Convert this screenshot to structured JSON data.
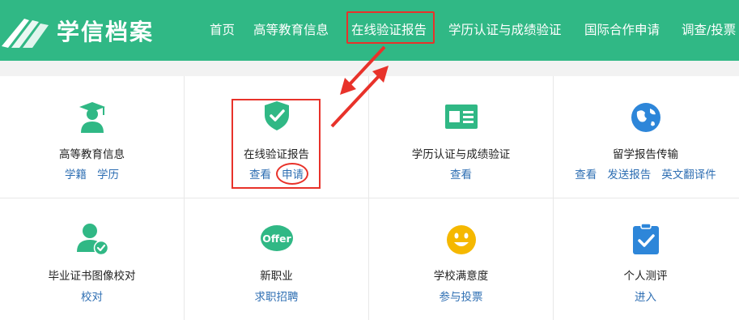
{
  "header": {
    "logo_text": "学信档案",
    "nav": [
      "首页",
      "高等教育信息",
      "在线验证报告",
      "学历认证与成绩验证",
      "国际合作申请",
      "调查/投票"
    ]
  },
  "cells": [
    {
      "title": "高等教育信息",
      "links": [
        "学籍",
        "学历"
      ],
      "icon": "graduate-icon"
    },
    {
      "title": "在线验证报告",
      "links": [
        "查看",
        "申请"
      ],
      "icon": "shield-check-icon"
    },
    {
      "title": "学历认证与成绩验证",
      "links": [
        "查看"
      ],
      "icon": "id-card-icon"
    },
    {
      "title": "留学报告传输",
      "links": [
        "查看",
        "发送报告",
        "英文翻译件"
      ],
      "icon": "globe-icon"
    },
    {
      "title": "毕业证书图像校对",
      "links": [
        "校对"
      ],
      "icon": "user-check-icon"
    },
    {
      "title": "新职业",
      "links": [
        "求职招聘"
      ],
      "icon": "offer-icon",
      "badge": "Offer"
    },
    {
      "title": "学校满意度",
      "links": [
        "参与投票"
      ],
      "icon": "smiley-icon"
    },
    {
      "title": "个人测评",
      "links": [
        "进入"
      ],
      "icon": "clipboard-check-icon"
    }
  ],
  "colors": {
    "brand_green": "#30b885",
    "link_blue": "#2f6fb3",
    "annotation_red": "#e8322a",
    "globe_blue": "#2d86d9",
    "smiley_yellow": "#f5b800"
  }
}
